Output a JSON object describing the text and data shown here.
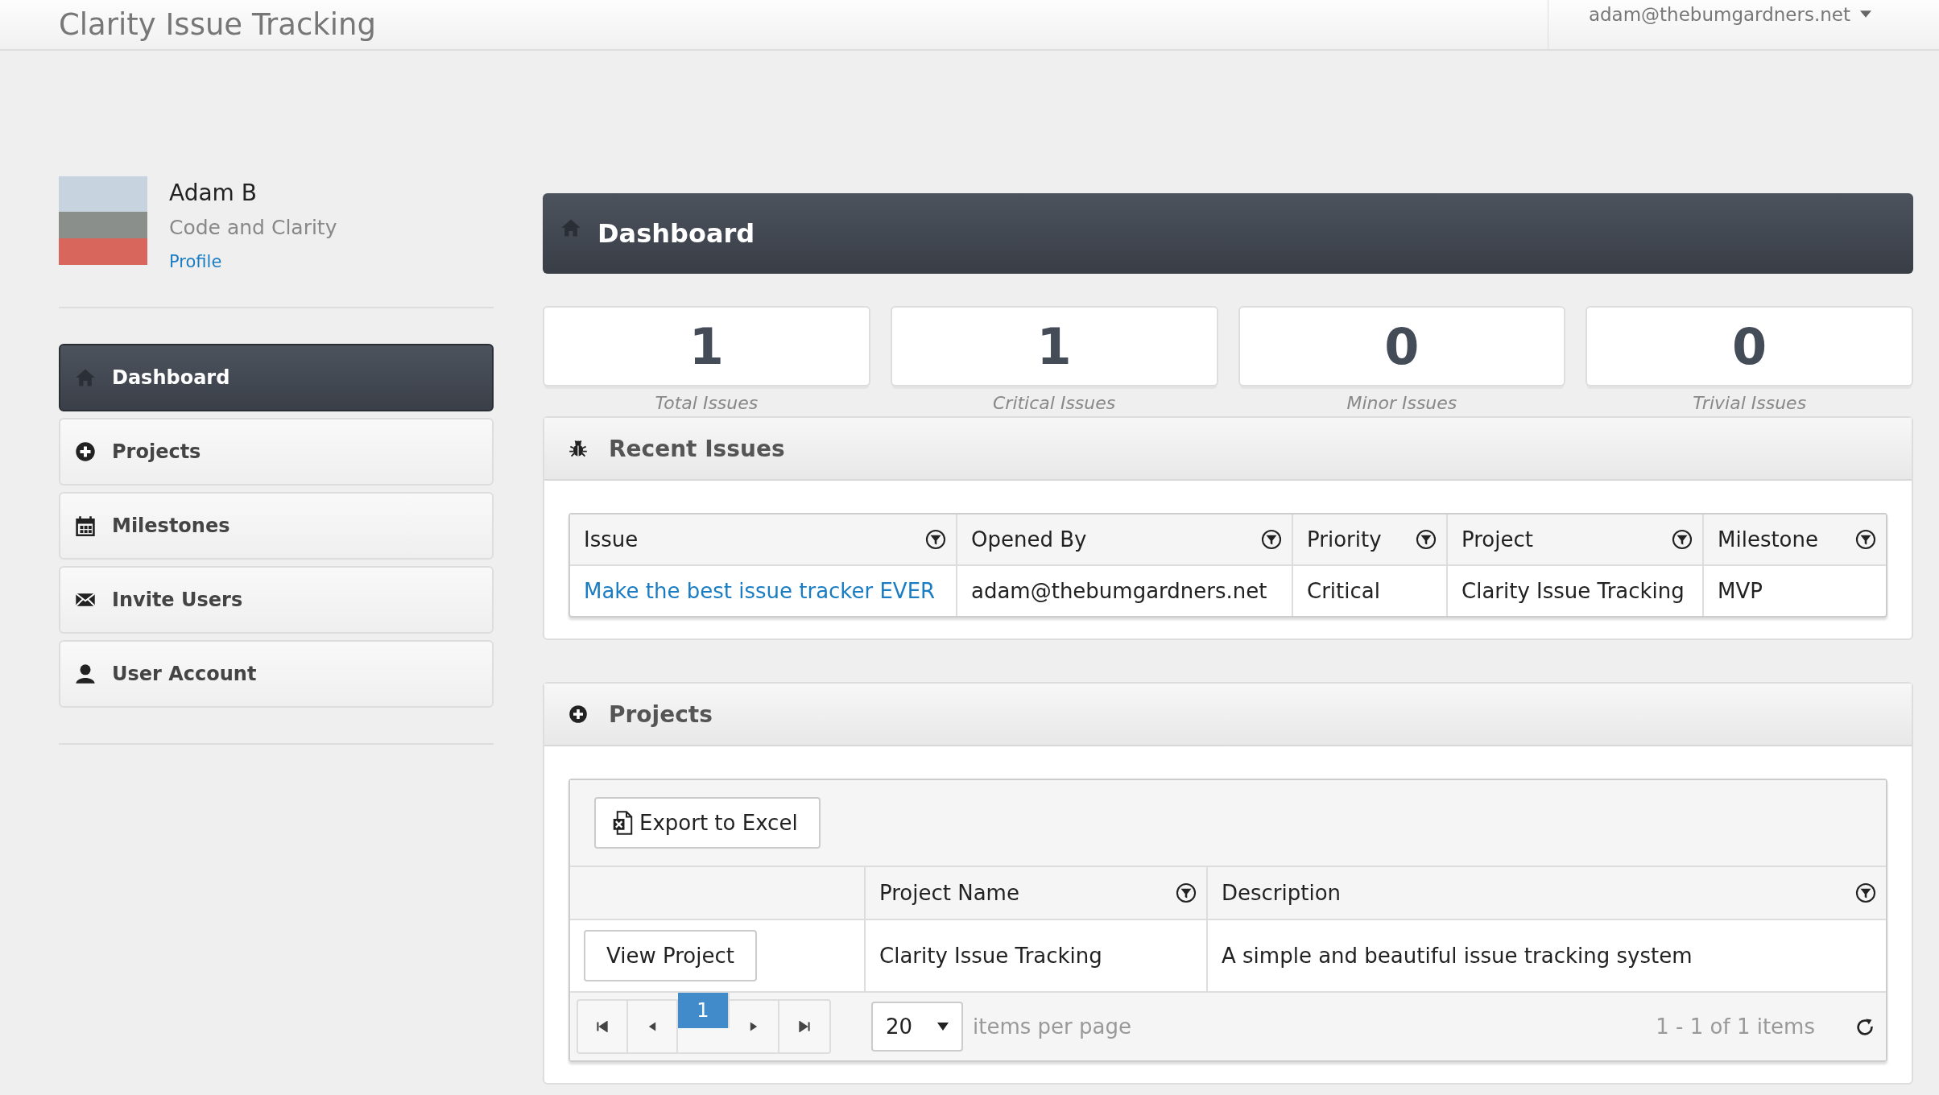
{
  "header": {
    "title": "Clarity Issue Tracking",
    "user_menu": "adam@thebumgardners.net"
  },
  "profile": {
    "name": "Adam B",
    "organization": "Code and Clarity",
    "link": "Profile"
  },
  "nav": [
    {
      "label": "Dashboard",
      "kind": "home",
      "selected": true
    },
    {
      "label": "Projects",
      "kind": "plus",
      "selected": false
    },
    {
      "label": "Milestones",
      "kind": "calendar",
      "selected": false
    },
    {
      "label": "Invite Users",
      "kind": "envelope",
      "selected": false
    },
    {
      "label": "User Account",
      "kind": "user",
      "selected": false
    }
  ],
  "page_title": "Dashboard",
  "stats": [
    {
      "value": "1",
      "label": "Total Issues"
    },
    {
      "value": "1",
      "label": "Critical Issues"
    },
    {
      "value": "0",
      "label": "Minor Issues"
    },
    {
      "value": "0",
      "label": "Trivial Issues"
    }
  ],
  "recent_issues": {
    "title": "Recent Issues",
    "columns": [
      "Issue",
      "Opened By",
      "Priority",
      "Project",
      "Milestone"
    ],
    "rows": [
      {
        "issue": "Make the best issue tracker EVER",
        "opened_by": "adam@thebumgardners.net",
        "priority": "Critical",
        "project": "Clarity Issue Tracking",
        "milestone": "MVP"
      }
    ]
  },
  "projects": {
    "title": "Projects",
    "export_button": "Export to Excel",
    "columns": [
      "Project Name",
      "Description"
    ],
    "rows": [
      {
        "action": "View Project",
        "name": "Clarity Issue Tracking",
        "description": "A simple and beautiful issue tracking system"
      }
    ],
    "pager": {
      "pages": [
        {
          "label": "1",
          "selected": true
        }
      ],
      "page_size": "20",
      "page_size_label": "items per page",
      "summary": "1 - 1 of 1 items"
    }
  }
}
